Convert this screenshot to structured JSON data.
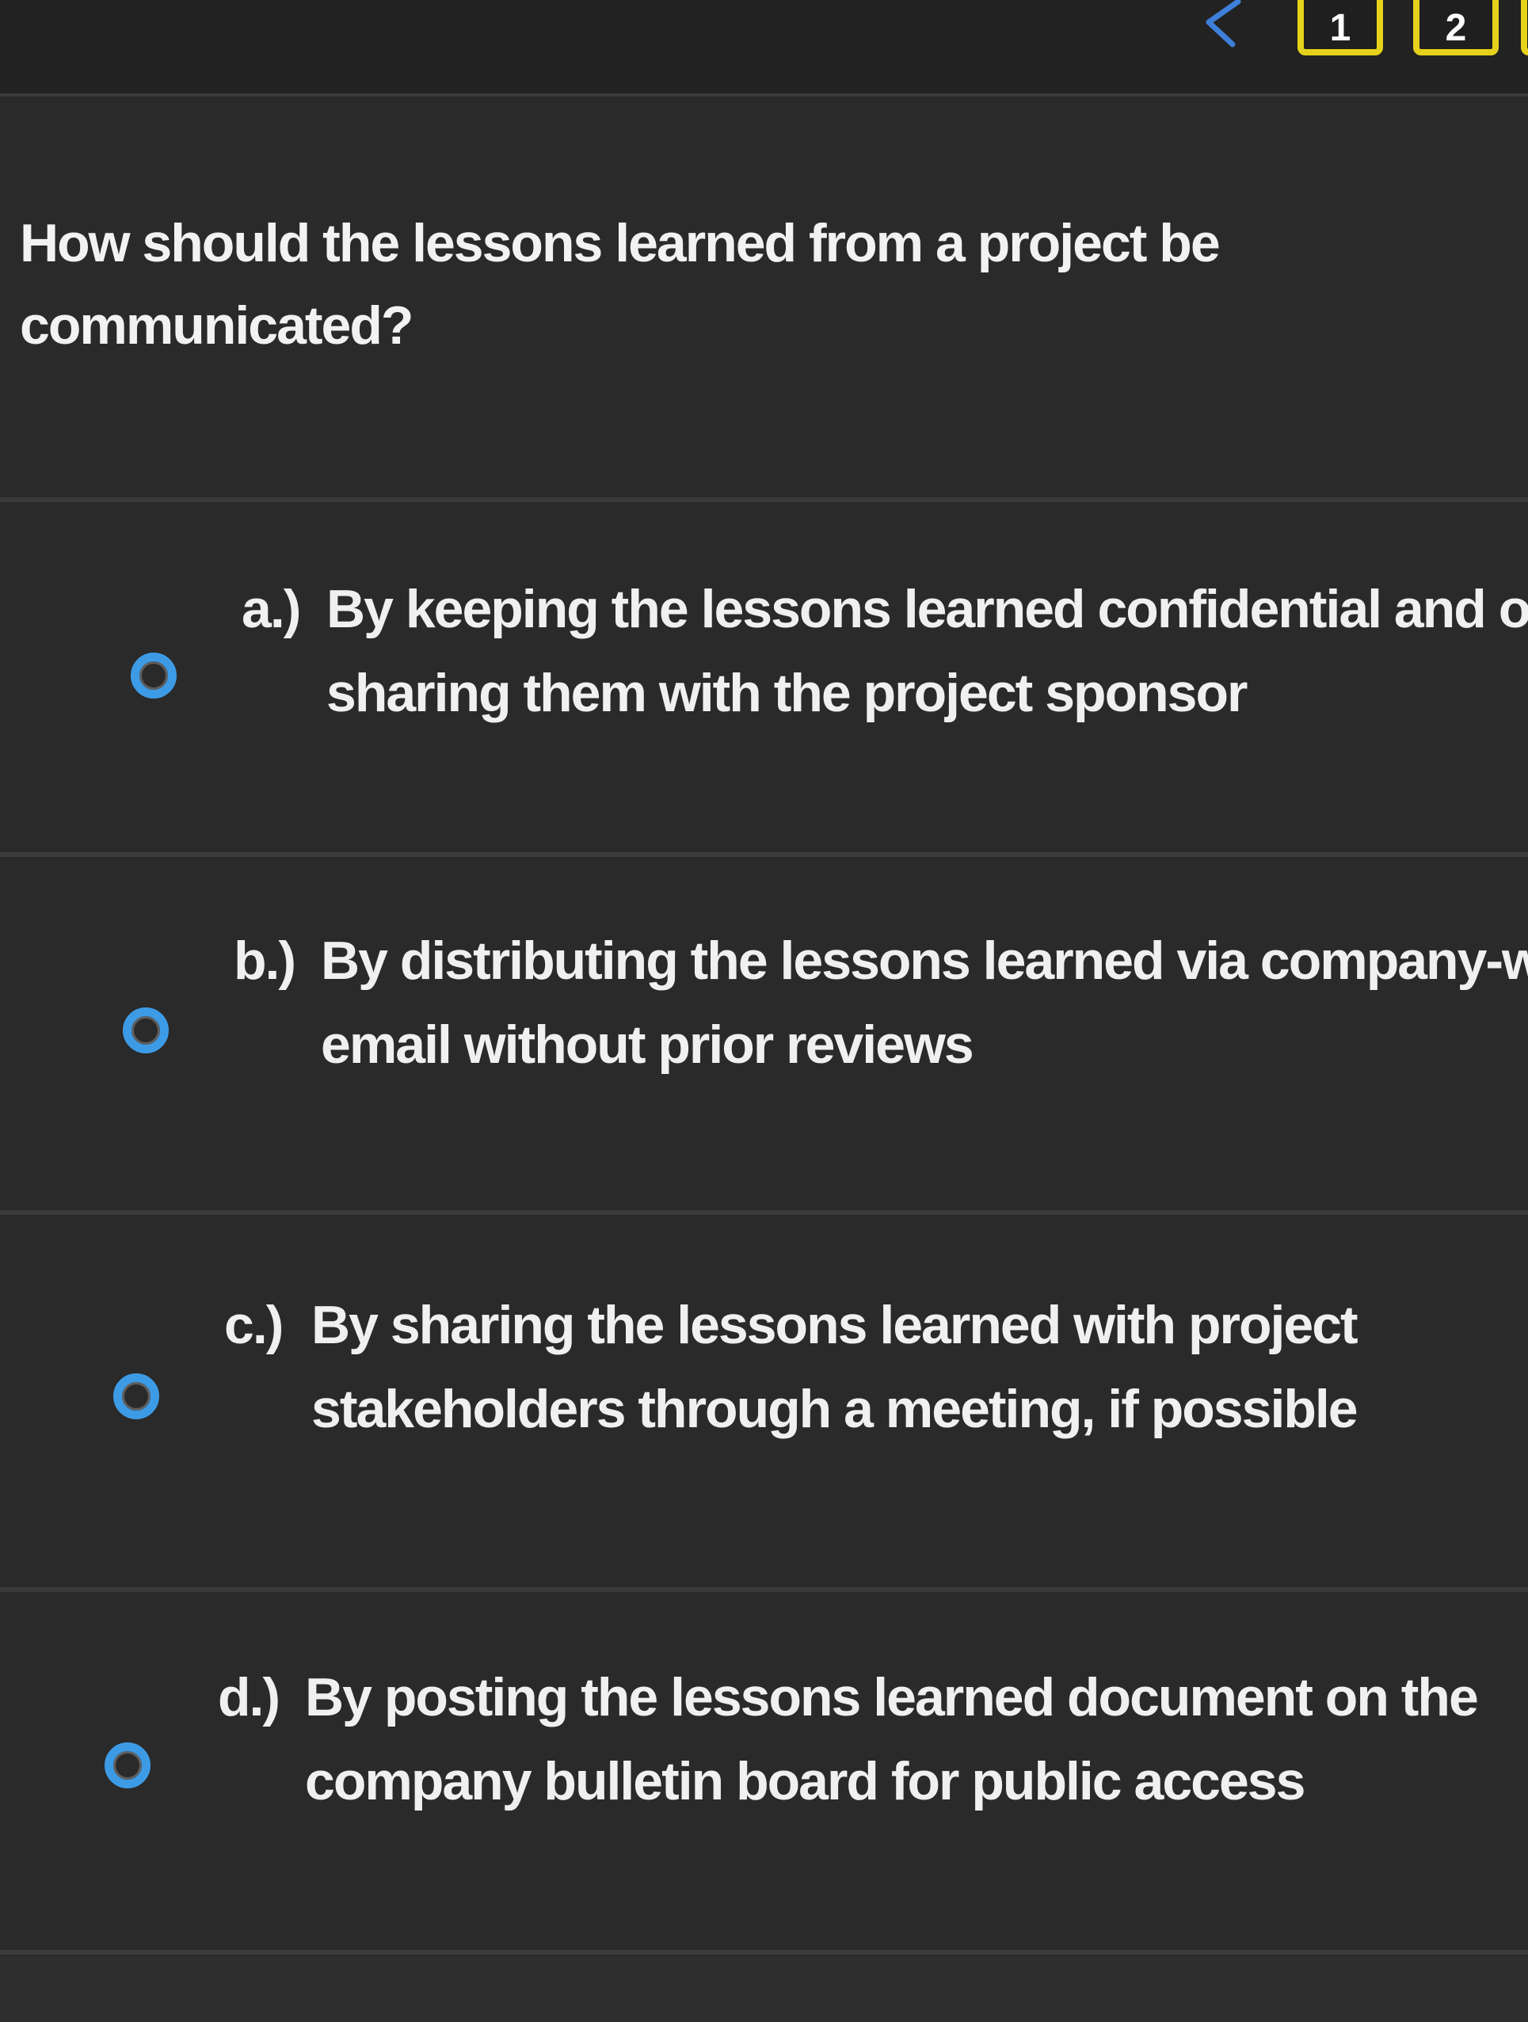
{
  "nav": {
    "back_icon": "chevron-left-icon",
    "pages": [
      "1",
      "2"
    ],
    "highlight_color": "#e6d21a"
  },
  "question": {
    "text": "How should the lessons learned from a project be communicated?"
  },
  "options": [
    {
      "letter": "a.)",
      "text": "By keeping the lessons learned confidential and only sharing them with the project sponsor"
    },
    {
      "letter": "b.)",
      "text": "By distributing the lessons learned via company-wide email without prior reviews"
    },
    {
      "letter": "c.)",
      "text": "By sharing the lessons learned with project stakeholders through a meeting, if possible"
    },
    {
      "letter": "d.)",
      "text": "By posting the lessons learned document on the company bulletin board for public access"
    }
  ],
  "colors": {
    "radio": "#3d9be6",
    "background": "#2a2a2a",
    "text": "#f0f0f0"
  }
}
